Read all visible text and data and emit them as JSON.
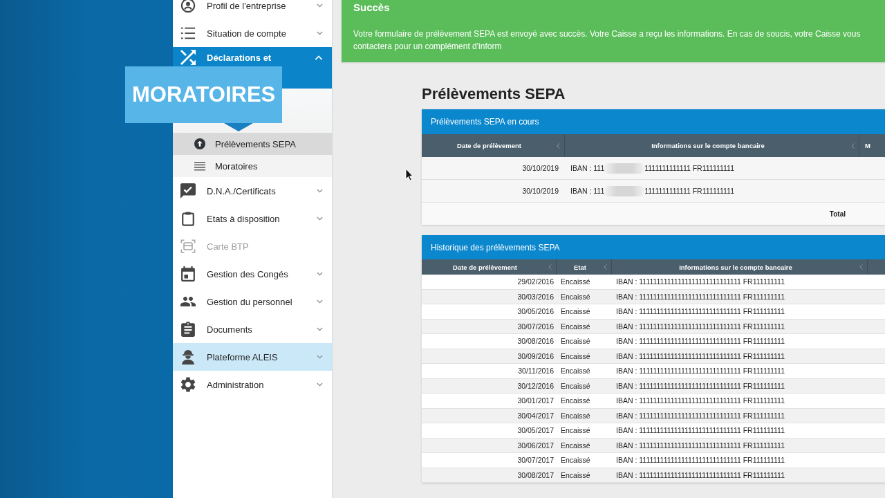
{
  "callout": {
    "label": "MORATOIRES"
  },
  "sidebar": {
    "items": [
      {
        "label": "Profil de l'entreprise",
        "expanded": false,
        "disabled": false,
        "hovered": false
      },
      {
        "label": "Situation de compte",
        "expanded": false,
        "disabled": false,
        "hovered": false
      },
      {
        "label": "Déclarations et",
        "expanded": true,
        "disabled": false,
        "hovered": false,
        "children": [
          {
            "label": "Prélèvements SEPA",
            "selected": true
          },
          {
            "label": "Moratoires",
            "selected": false
          }
        ]
      },
      {
        "label": "D.N.A./Certificats",
        "expanded": false,
        "disabled": false,
        "hovered": false
      },
      {
        "label": "Etats à disposition",
        "expanded": false,
        "disabled": false,
        "hovered": false
      },
      {
        "label": "Carte BTP",
        "expanded": false,
        "disabled": true,
        "hovered": false
      },
      {
        "label": "Gestion des Congés",
        "expanded": false,
        "disabled": false,
        "hovered": false
      },
      {
        "label": "Gestion du personnel",
        "expanded": false,
        "disabled": false,
        "hovered": false
      },
      {
        "label": "Documents",
        "expanded": false,
        "disabled": false,
        "hovered": false
      },
      {
        "label": "Plateforme ALEIS",
        "expanded": false,
        "disabled": false,
        "hovered": true
      },
      {
        "label": "Administration",
        "expanded": false,
        "disabled": false,
        "hovered": false
      }
    ]
  },
  "alert": {
    "kind": "success",
    "title": "Succès",
    "message": "Votre formulaire de prélèvement SEPA est envoyé avec succès. Votre Caisse a reçu les informations. En cas de soucis, votre Caisse vous contactera pour un complément d'inform"
  },
  "page_title": "Prélèvements SEPA",
  "current_table": {
    "title": "Prélèvements SEPA en cours",
    "columns": [
      "Date de prélèvement",
      "Informations sur le compte bancaire",
      "M"
    ],
    "rows": [
      {
        "date": "30/10/2019",
        "iban_start": "IBAN : 111",
        "iban_end": "1111111111111 FR111111111"
      },
      {
        "date": "30/10/2019",
        "iban_start": "IBAN : 111",
        "iban_end": "1111111111111 FR111111111"
      }
    ],
    "footer": "Total"
  },
  "history_table": {
    "title": "Historique des prélèvements SEPA",
    "columns": [
      "Date de prélèvement",
      "Etat",
      "Informations sur le compte bancaire"
    ],
    "rows": [
      {
        "date": "29/02/2016",
        "state": "Encaissé",
        "account": "IBAN : 11111111111111111111111111111 FR111111111"
      },
      {
        "date": "30/03/2016",
        "state": "Encaissé",
        "account": "IBAN : 11111111111111111111111111111 FR111111111"
      },
      {
        "date": "30/05/2016",
        "state": "Encaissé",
        "account": "IBAN : 11111111111111111111111111111 FR111111111"
      },
      {
        "date": "30/07/2016",
        "state": "Encaissé",
        "account": "IBAN : 11111111111111111111111111111 FR111111111"
      },
      {
        "date": "30/08/2016",
        "state": "Encaissé",
        "account": "IBAN : 11111111111111111111111111111 FR111111111"
      },
      {
        "date": "30/09/2016",
        "state": "Encaissé",
        "account": "IBAN : 11111111111111111111111111111 FR111111111"
      },
      {
        "date": "30/11/2016",
        "state": "Encaissé",
        "account": "IBAN : 11111111111111111111111111111 FR111111111"
      },
      {
        "date": "30/12/2016",
        "state": "Encaissé",
        "account": "IBAN : 11111111111111111111111111111 FR111111111"
      },
      {
        "date": "30/01/2017",
        "state": "Encaissé",
        "account": "IBAN : 11111111111111111111111111111 FR111111111"
      },
      {
        "date": "30/04/2017",
        "state": "Encaissé",
        "account": "IBAN : 11111111111111111111111111111 FR111111111"
      },
      {
        "date": "30/05/2017",
        "state": "Encaissé",
        "account": "IBAN : 11111111111111111111111111111 FR111111111"
      },
      {
        "date": "30/06/2017",
        "state": "Encaissé",
        "account": "IBAN : 11111111111111111111111111111 FR111111111"
      },
      {
        "date": "30/07/2017",
        "state": "Encaissé",
        "account": "IBAN : 11111111111111111111111111111 FR111111111"
      },
      {
        "date": "30/08/2017",
        "state": "Encaissé",
        "account": "IBAN : 11111111111111111111111111111 FR111111111"
      }
    ]
  }
}
